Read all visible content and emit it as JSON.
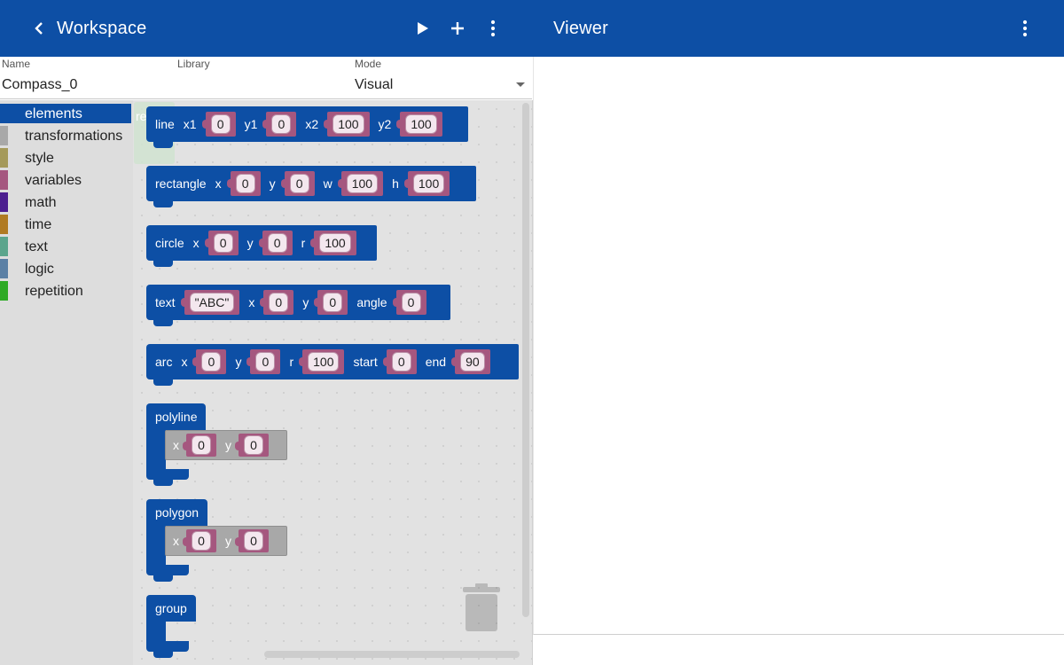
{
  "workspace_bar": {
    "title": "Workspace"
  },
  "viewer_bar": {
    "title": "Viewer"
  },
  "form": {
    "name_label": "Name",
    "name_value": "Compass_0",
    "library_label": "Library",
    "library_value": "",
    "mode_label": "Mode",
    "mode_value": "Visual"
  },
  "toolbox": {
    "categories": [
      {
        "label": "elements",
        "color": "#0d4fa5",
        "selected": true
      },
      {
        "label": "transformations",
        "color": "#a8a8a8"
      },
      {
        "label": "style",
        "color": "#a59a5a"
      },
      {
        "label": "variables",
        "color": "#a5577f"
      },
      {
        "label": "math",
        "color": "#4c1e8f"
      },
      {
        "label": "time",
        "color": "#b07a22"
      },
      {
        "label": "text",
        "color": "#5ba58c"
      },
      {
        "label": "logic",
        "color": "#5b80a5"
      },
      {
        "label": "repetition",
        "color": "#2eaa25"
      }
    ]
  },
  "ghost_label": "re",
  "blocks": {
    "line": {
      "kw": "line",
      "x1": "x1",
      "x1_val": "0",
      "y1": "y1",
      "y1_val": "0",
      "x2": "x2",
      "x2_val": "100",
      "y2": "y2",
      "y2_val": "100"
    },
    "rectangle": {
      "kw": "rectangle",
      "x": "x",
      "x_val": "0",
      "y": "y",
      "y_val": "0",
      "w": "w",
      "w_val": "100",
      "h": "h",
      "h_val": "100"
    },
    "circle": {
      "kw": "circle",
      "x": "x",
      "x_val": "0",
      "y": "y",
      "y_val": "0",
      "r": "r",
      "r_val": "100"
    },
    "text": {
      "kw": "text",
      "str_val": "\"ABC\"",
      "x": "x",
      "x_val": "0",
      "y": "y",
      "y_val": "0",
      "angle": "angle",
      "angle_val": "0"
    },
    "arc": {
      "kw": "arc",
      "x": "x",
      "x_val": "0",
      "y": "y",
      "y_val": "0",
      "r": "r",
      "r_val": "100",
      "start": "start",
      "start_val": "0",
      "end": "end",
      "end_val": "90"
    },
    "polyline": {
      "kw": "polyline",
      "x": "x",
      "x_val": "0",
      "y": "y",
      "y_val": "0"
    },
    "polygon": {
      "kw": "polygon",
      "x": "x",
      "x_val": "0",
      "y": "y",
      "y_val": "0"
    },
    "group": {
      "kw": "group"
    }
  },
  "icons": {
    "back": "chevron-left-icon",
    "run": "play-icon",
    "add": "plus-icon",
    "menu": "more-vert-icon",
    "trash": "trash-icon",
    "dropdown": "caret-down-icon"
  }
}
